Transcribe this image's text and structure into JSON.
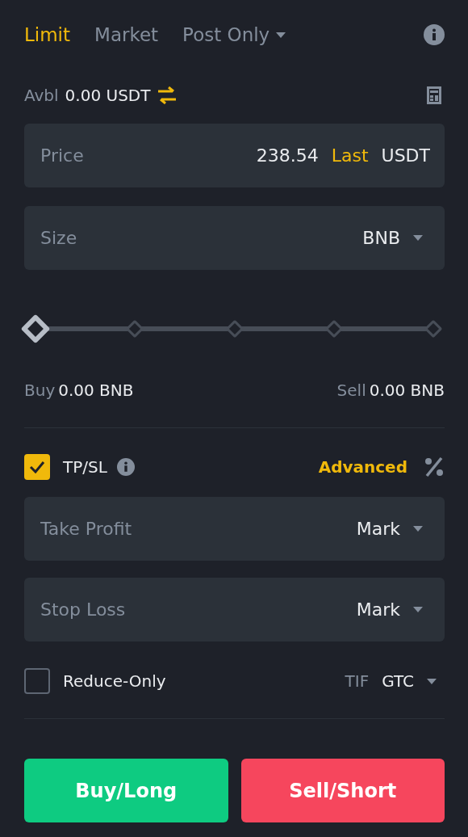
{
  "order_types": [
    {
      "label": "Limit",
      "selected": true,
      "dropdown": false
    },
    {
      "label": "Market",
      "selected": false,
      "dropdown": false
    },
    {
      "label": "Post Only",
      "selected": false,
      "dropdown": true
    }
  ],
  "available": {
    "label": "Avbl",
    "value": "0.00 USDT"
  },
  "price_field": {
    "placeholder": "Price",
    "value": "238.54",
    "tag": "Last",
    "unit": "USDT"
  },
  "size_field": {
    "placeholder": "Size",
    "unit": "BNB"
  },
  "size_slider": {
    "level": 0
  },
  "buy_amount": {
    "label": "Buy",
    "value": "0.00 BNB"
  },
  "sell_amount": {
    "label": "Sell",
    "value": "0.00 BNB"
  },
  "tpsl": {
    "label": "TP/SL",
    "checked": true,
    "advanced": "Advanced"
  },
  "take_profit": {
    "placeholder": "Take Profit",
    "trigger": "Mark"
  },
  "stop_loss": {
    "placeholder": "Stop Loss",
    "trigger": "Mark"
  },
  "reduce_only": {
    "label": "Reduce-Only",
    "checked": false
  },
  "tif": {
    "label": "TIF",
    "value": "GTC"
  },
  "buttons": [
    {
      "label": "Buy/Long",
      "kind": "buy"
    },
    {
      "label": "Sell/Short",
      "kind": "sell"
    }
  ]
}
